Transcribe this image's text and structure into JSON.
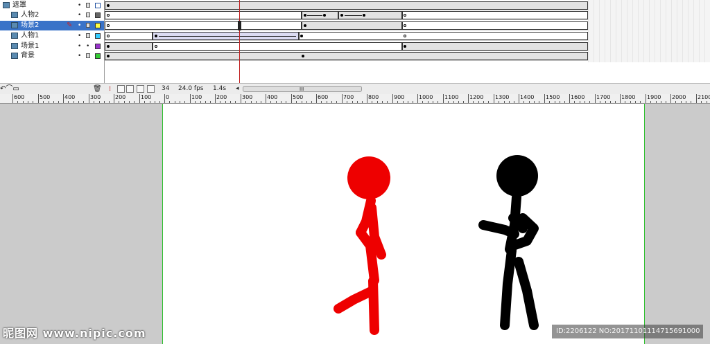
{
  "timeline": {
    "layers": [
      {
        "name": "遮罩",
        "type": "mask",
        "color": "#ffffff",
        "selected": false
      },
      {
        "name": "人物2",
        "type": "masked",
        "color": "#666666",
        "selected": false
      },
      {
        "name": "场景2",
        "type": "masked",
        "color": "#ffff44",
        "selected": true
      },
      {
        "name": "人物1",
        "type": "masked",
        "color": "#33ccff",
        "selected": false
      },
      {
        "name": "场景1",
        "type": "masked",
        "color": "#9933cc",
        "selected": false
      },
      {
        "name": "背景",
        "type": "masked",
        "color": "#33cc33",
        "selected": false
      }
    ],
    "status": {
      "current_frame": "34",
      "fps": "24.0 fps",
      "elapsed": "1.4s",
      "scroll_grip": "III"
    }
  },
  "ruler": {
    "labels": [
      "600",
      "500",
      "400",
      "300",
      "200",
      "100",
      "0",
      "100",
      "200",
      "300",
      "400",
      "500",
      "600",
      "700",
      "800",
      "900",
      "1000",
      "1100",
      "1200",
      "1300",
      "1400",
      "1500",
      "1600",
      "1700",
      "1800",
      "1900",
      "2000",
      "2100"
    ]
  },
  "stage": {
    "figures": [
      {
        "name": "red-stick-figure",
        "color": "#ee0000"
      },
      {
        "name": "black-stick-figure",
        "color": "#000000"
      }
    ]
  },
  "watermark": {
    "left_text": "昵图网 www.nipic.com",
    "right_text": "ID:2206122 NO:20171101114715691000"
  },
  "colors": {
    "accent_selected": "#3a73c8",
    "playhead": "#c02020",
    "stage_border": "#2ec02e"
  }
}
